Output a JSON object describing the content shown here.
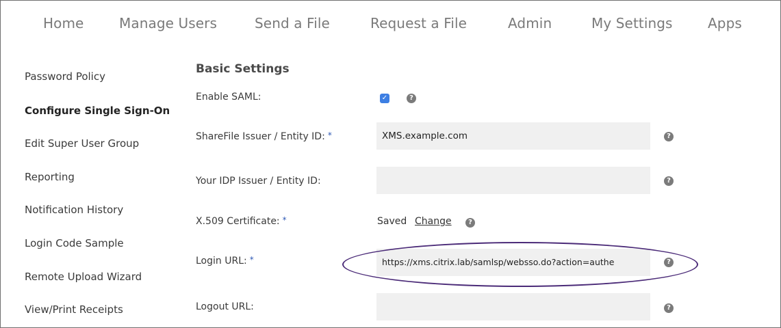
{
  "nav": {
    "items": [
      "Home",
      "Manage Users",
      "Send a File",
      "Request a File",
      "Admin",
      "My Settings",
      "Apps"
    ]
  },
  "sidebar": {
    "items": [
      {
        "label": "Password Policy",
        "active": false
      },
      {
        "label": "Configure Single Sign-On",
        "active": true
      },
      {
        "label": "Edit Super User Group",
        "active": false
      },
      {
        "label": "Reporting",
        "active": false
      },
      {
        "label": "Notification History",
        "active": false
      },
      {
        "label": "Login Code Sample",
        "active": false
      },
      {
        "label": "Remote Upload Wizard",
        "active": false
      },
      {
        "label": "View/Print Receipts",
        "active": false
      }
    ]
  },
  "main": {
    "section_title": "Basic Settings",
    "required_marker": "*",
    "help_glyph": "?",
    "enable_saml": {
      "label": "Enable SAML:",
      "checked": true,
      "check_glyph": "✓"
    },
    "issuer_entity_id": {
      "label": "ShareFile Issuer / Entity ID:",
      "value": "XMS.example.com"
    },
    "idp_entity_id": {
      "label": "Your IDP Issuer / Entity ID:",
      "value": ""
    },
    "certificate": {
      "label": "X.509 Certificate:",
      "status": "Saved",
      "change_link": "Change"
    },
    "login_url": {
      "label": "Login URL:",
      "value": "https://xms.citrix.lab/samlsp/websso.do?action=authe"
    },
    "logout_url": {
      "label": "Logout URL:",
      "value": ""
    }
  },
  "colors": {
    "accent_checkbox": "#3d7fe3",
    "highlight_ellipse": "#4b2b78",
    "required_marker": "#2f59b5",
    "field_background": "#f0f0f0"
  }
}
